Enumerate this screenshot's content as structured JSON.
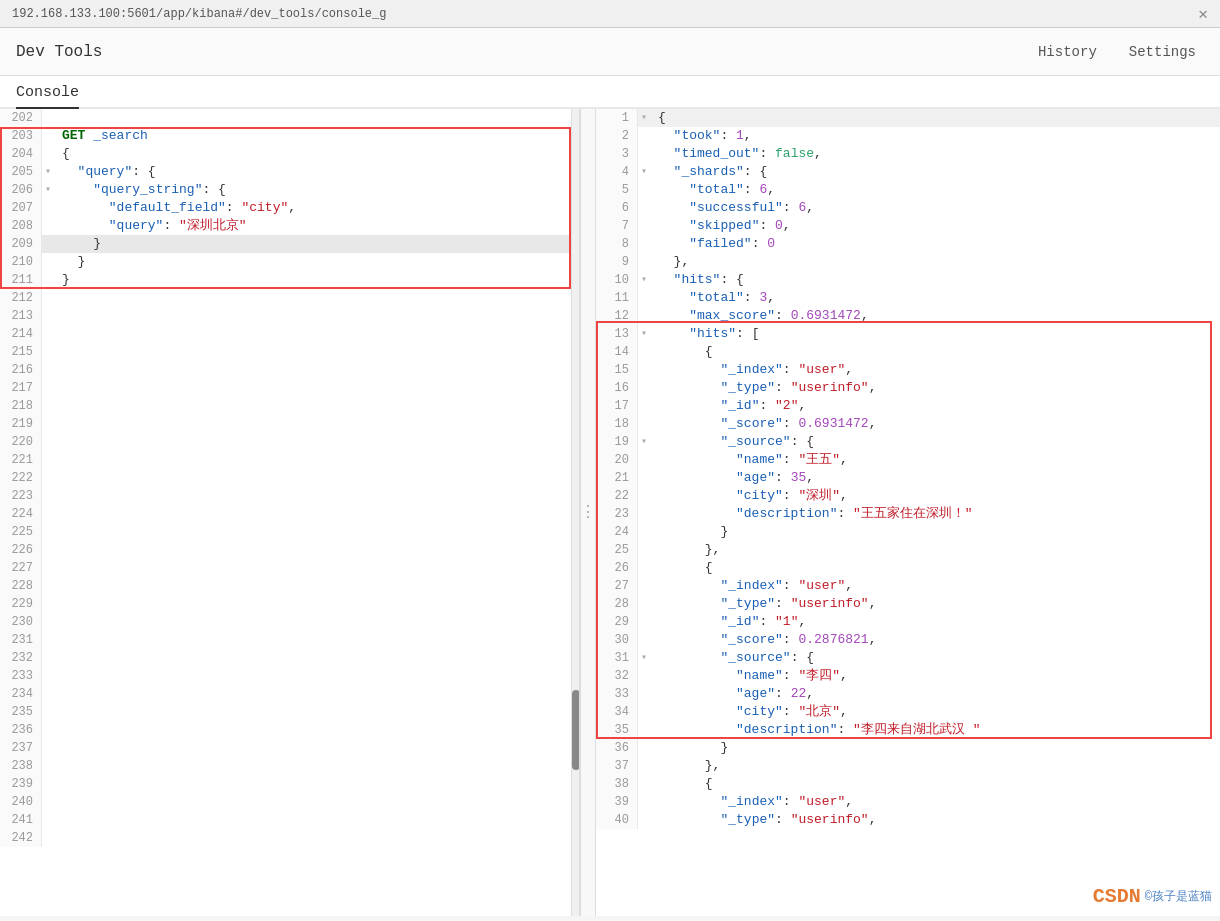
{
  "topbar": {
    "url": "192.168.133.100:5601/app/kibana#/dev_tools/console_g",
    "close_icon": "✕"
  },
  "devtools": {
    "title": "Dev Tools",
    "nav": [
      {
        "label": "History",
        "id": "history"
      },
      {
        "label": "Settings",
        "id": "settings"
      }
    ]
  },
  "console": {
    "tab_label": "Console"
  },
  "editor": {
    "lines": [
      {
        "num": "202",
        "content": ""
      },
      {
        "num": "203",
        "content": "GET _search",
        "type": "method_endpoint"
      },
      {
        "num": "204",
        "content": "{"
      },
      {
        "num": "205",
        "content": "  \"query\": {",
        "fold": true
      },
      {
        "num": "206",
        "content": "    \"query_string\": {",
        "fold": true
      },
      {
        "num": "207",
        "content": "      \"default_field\": \"city\","
      },
      {
        "num": "208",
        "content": "      \"query\": \"深圳北京\""
      },
      {
        "num": "209",
        "content": "    }"
      },
      {
        "num": "210",
        "content": "  }"
      },
      {
        "num": "211",
        "content": "}"
      },
      {
        "num": "212",
        "content": ""
      },
      {
        "num": "213",
        "content": ""
      },
      {
        "num": "214",
        "content": ""
      },
      {
        "num": "215",
        "content": ""
      },
      {
        "num": "216",
        "content": ""
      },
      {
        "num": "217",
        "content": ""
      },
      {
        "num": "218",
        "content": ""
      },
      {
        "num": "219",
        "content": ""
      },
      {
        "num": "220",
        "content": ""
      },
      {
        "num": "221",
        "content": ""
      },
      {
        "num": "222",
        "content": ""
      },
      {
        "num": "223",
        "content": ""
      },
      {
        "num": "224",
        "content": ""
      },
      {
        "num": "225",
        "content": ""
      },
      {
        "num": "226",
        "content": ""
      },
      {
        "num": "227",
        "content": ""
      },
      {
        "num": "228",
        "content": ""
      },
      {
        "num": "229",
        "content": ""
      },
      {
        "num": "230",
        "content": ""
      },
      {
        "num": "231",
        "content": ""
      },
      {
        "num": "232",
        "content": ""
      },
      {
        "num": "233",
        "content": ""
      },
      {
        "num": "234",
        "content": ""
      },
      {
        "num": "235",
        "content": ""
      },
      {
        "num": "236",
        "content": ""
      },
      {
        "num": "237",
        "content": ""
      },
      {
        "num": "238",
        "content": ""
      },
      {
        "num": "239",
        "content": ""
      },
      {
        "num": "240",
        "content": ""
      },
      {
        "num": "241",
        "content": ""
      },
      {
        "num": "242",
        "content": ""
      }
    ],
    "play_button": "▶",
    "wrench_button": "🔧"
  },
  "output": {
    "lines": [
      {
        "num": "1",
        "fold": true,
        "html": "{"
      },
      {
        "num": "2",
        "fold": false,
        "html": "  <span class='json-key'>\"took\"</span>: <span class='json-number'>1</span>,"
      },
      {
        "num": "3",
        "fold": false,
        "html": "  <span class='json-key'>\"timed_out\"</span>: <span class='json-bool'>false</span>,"
      },
      {
        "num": "4",
        "fold": true,
        "html": "  <span class='json-key'>\"_shards\"</span>: {"
      },
      {
        "num": "5",
        "fold": false,
        "html": "    <span class='json-key'>\"total\"</span>: <span class='json-number'>6</span>,"
      },
      {
        "num": "6",
        "fold": false,
        "html": "    <span class='json-key'>\"successful\"</span>: <span class='json-number'>6</span>,"
      },
      {
        "num": "7",
        "fold": false,
        "html": "    <span class='json-key'>\"skipped\"</span>: <span class='json-number'>0</span>,"
      },
      {
        "num": "8",
        "fold": false,
        "html": "    <span class='json-key'>\"failed\"</span>: <span class='json-number'>0</span>"
      },
      {
        "num": "9",
        "fold": false,
        "html": "  },"
      },
      {
        "num": "10",
        "fold": true,
        "html": "  <span class='json-key'>\"hits\"</span>: {"
      },
      {
        "num": "11",
        "fold": false,
        "html": "    <span class='json-key'>\"total\"</span>: <span class='json-number'>3</span>,"
      },
      {
        "num": "12",
        "fold": false,
        "html": "    <span class='json-key'>\"max_score\"</span>: <span class='json-number'>0.6931472</span>,"
      },
      {
        "num": "13",
        "fold": true,
        "html": "    <span class='json-key'>\"hits\"</span>: ["
      },
      {
        "num": "14",
        "fold": false,
        "html": "      {"
      },
      {
        "num": "15",
        "fold": false,
        "html": "        <span class='json-key'>\"_index\"</span>: <span class='json-string'>\"user\"</span>,"
      },
      {
        "num": "16",
        "fold": false,
        "html": "        <span class='json-key'>\"_type\"</span>: <span class='json-string'>\"userinfo\"</span>,"
      },
      {
        "num": "17",
        "fold": false,
        "html": "        <span class='json-key'>\"_id\"</span>: <span class='json-string'>\"2\"</span>,"
      },
      {
        "num": "18",
        "fold": false,
        "html": "        <span class='json-key'>\"_score\"</span>: <span class='json-number'>0.6931472</span>,"
      },
      {
        "num": "19",
        "fold": true,
        "html": "        <span class='json-key'>\"_source\"</span>: {"
      },
      {
        "num": "20",
        "fold": false,
        "html": "          <span class='json-key'>\"name\"</span>: <span class='json-string'>\"王五\"</span>,"
      },
      {
        "num": "21",
        "fold": false,
        "html": "          <span class='json-key'>\"age\"</span>: <span class='json-number'>35</span>,"
      },
      {
        "num": "22",
        "fold": false,
        "html": "          <span class='json-key'>\"city\"</span>: <span class='json-string'>\"深圳\"</span>,"
      },
      {
        "num": "23",
        "fold": false,
        "html": "          <span class='json-key'>\"description\"</span>: <span class='json-string'>\"王五家住在深圳！\"</span>"
      },
      {
        "num": "24",
        "fold": false,
        "html": "        }"
      },
      {
        "num": "25",
        "fold": false,
        "html": "      },"
      },
      {
        "num": "26",
        "fold": false,
        "html": "      {"
      },
      {
        "num": "27",
        "fold": false,
        "html": "        <span class='json-key'>\"_index\"</span>: <span class='json-string'>\"user\"</span>,"
      },
      {
        "num": "28",
        "fold": false,
        "html": "        <span class='json-key'>\"_type\"</span>: <span class='json-string'>\"userinfo\"</span>,"
      },
      {
        "num": "29",
        "fold": false,
        "html": "        <span class='json-key'>\"_id\"</span>: <span class='json-string'>\"1\"</span>,"
      },
      {
        "num": "30",
        "fold": false,
        "html": "        <span class='json-key'>\"_score\"</span>: <span class='json-number'>0.2876821</span>,"
      },
      {
        "num": "31",
        "fold": true,
        "html": "        <span class='json-key'>\"_source\"</span>: {"
      },
      {
        "num": "32",
        "fold": false,
        "html": "          <span class='json-key'>\"name\"</span>: <span class='json-string'>\"李四\"</span>,"
      },
      {
        "num": "33",
        "fold": false,
        "html": "          <span class='json-key'>\"age\"</span>: <span class='json-number'>22</span>,"
      },
      {
        "num": "34",
        "fold": false,
        "html": "          <span class='json-key'>\"city\"</span>: <span class='json-string'>\"北京\"</span>,"
      },
      {
        "num": "35",
        "fold": false,
        "html": "          <span class='json-key'>\"description\"</span>: <span class='json-string'>\"李四来自湖北武汉 \"</span>"
      },
      {
        "num": "36",
        "fold": false,
        "html": "        }"
      },
      {
        "num": "37",
        "fold": false,
        "html": "      },"
      },
      {
        "num": "38",
        "fold": false,
        "html": "      {"
      },
      {
        "num": "39",
        "fold": false,
        "html": "        <span class='json-key'>\"_index\"</span>: <span class='json-string'>\"user\"</span>,"
      },
      {
        "num": "40",
        "fold": false,
        "html": "        <span class='json-key'>\"_type\"</span>: <span class='json-string'>\"userinfo\"</span>,"
      }
    ]
  },
  "watermark": {
    "text": "CSDN",
    "subtext": "©孩子是蓝猫",
    "icon": "🅒"
  }
}
